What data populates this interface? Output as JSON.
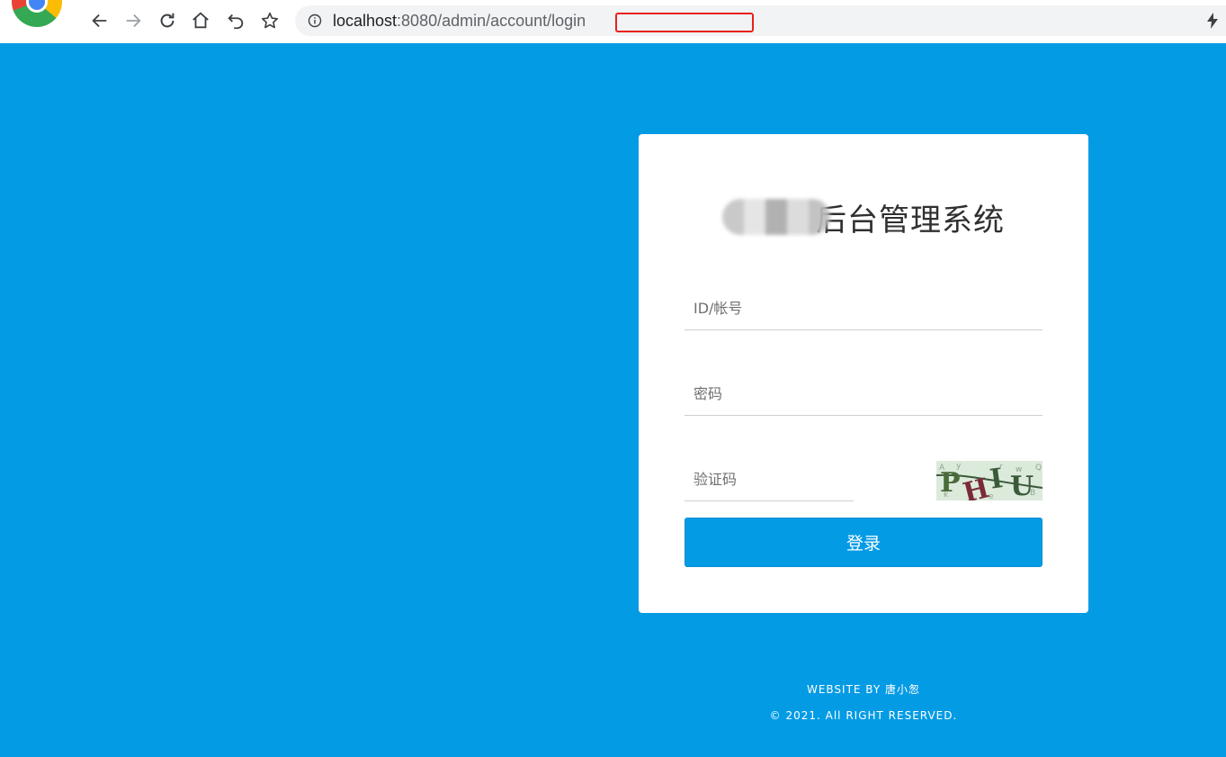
{
  "browser": {
    "url_host": "localhost",
    "url_rest": ":8080/admin/account/login",
    "icons": [
      "back-icon",
      "forward-icon",
      "reload-icon",
      "home-icon",
      "undo-icon",
      "star-icon",
      "info-icon",
      "lightning-icon"
    ]
  },
  "login": {
    "title": "后台管理系统",
    "username_placeholder": "ID/帐号",
    "password_placeholder": "密码",
    "captcha_placeholder": "验证码",
    "captcha_text": "PHIU",
    "submit_label": "登录"
  },
  "footer": {
    "line1": "WEBSITE BY 唐小怱",
    "line2": "© 2021. All RIGHT RESERVED."
  },
  "colors": {
    "page_background": "#049be5",
    "button": "#049be5",
    "card": "#ffffff"
  }
}
